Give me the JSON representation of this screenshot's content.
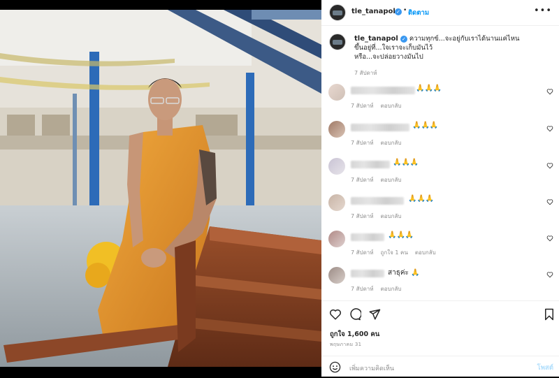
{
  "post": {
    "username": "tle_tanapol",
    "follow_label": "ติดตาม",
    "more_label": "•••",
    "caption_lines": [
      "ความทุกข์...จะอยู่กับเราได้นานแค่ไหน",
      "ขึ้นอยู่ที่...ใจเราจะเก็บมันไว้",
      "หรือ...จะปล่อยวางมันไป"
    ],
    "caption_time": "7 สัปดาห์",
    "likes": "ถูกใจ 1,600 คน",
    "date": "พฤษภาคม 31",
    "add_comment_placeholder": "เพิ่มความคิดเห็น",
    "post_label": "โพสต์"
  },
  "comments": [
    {
      "text": "🙏🙏🙏",
      "time": "7 สัปดาห์",
      "likes": "",
      "reply": "ตอบกลับ"
    },
    {
      "text": "🙏🙏🙏",
      "time": "7 สัปดาห์",
      "likes": "",
      "reply": "ตอบกลับ"
    },
    {
      "text": "🙏🙏🙏",
      "time": "7 สัปดาห์",
      "likes": "",
      "reply": "ตอบกลับ"
    },
    {
      "text": "🙏🙏🙏",
      "time": "7 สัปดาห์",
      "likes": "",
      "reply": "ตอบกลับ"
    },
    {
      "text": "🙏🙏🙏",
      "time": "7 สัปดาห์",
      "likes": "ถูกใจ 1 คน",
      "reply": "ตอบกลับ"
    },
    {
      "text": "สาธุค่ะ 🙏",
      "time": "7 สัปดาห์",
      "likes": "",
      "reply": "ตอบกลับ"
    }
  ],
  "colors": {
    "accent": "#0095f6",
    "robe": "#e0932c"
  }
}
